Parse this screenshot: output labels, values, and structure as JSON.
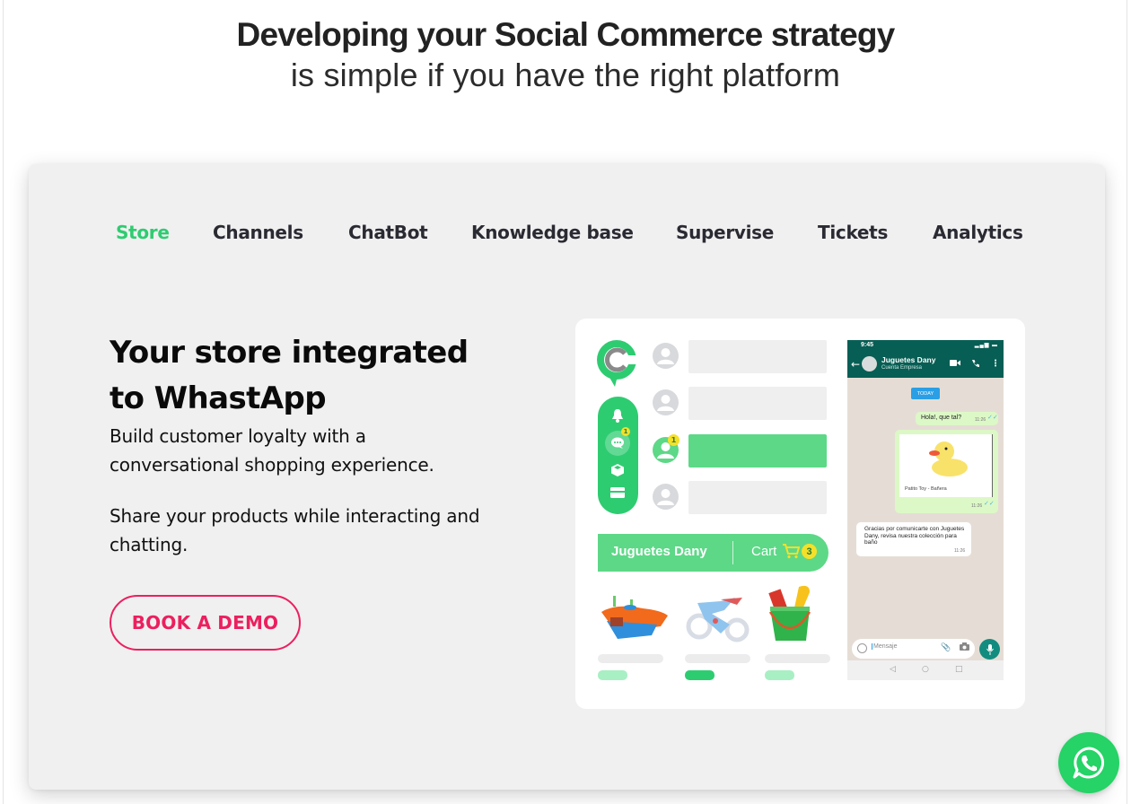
{
  "hero": {
    "title": "Developing your Social Commerce strategy",
    "subtitle": "is simple if you have the right platform"
  },
  "tabs": [
    {
      "label": "Store",
      "active": true
    },
    {
      "label": "Channels",
      "active": false
    },
    {
      "label": "ChatBot",
      "active": false
    },
    {
      "label": "Knowledge base",
      "active": false
    },
    {
      "label": "Supervise",
      "active": false
    },
    {
      "label": "Tickets",
      "active": false
    },
    {
      "label": "Analytics",
      "active": false
    }
  ],
  "content": {
    "heading": "Your store integrated to WhastApp",
    "paragraph1": "Build customer loyalty with a conversational shopping experience.",
    "paragraph2": "Share your products while interacting and chatting.",
    "cta_label": "BOOK A DEMO"
  },
  "mockup": {
    "sidebar_icons": [
      "bell-icon",
      "chat-icon",
      "box-icon",
      "card-icon"
    ],
    "chat_badge": "1",
    "active_conversation_badge": "1",
    "store_name": "Juguetes Dany",
    "cart_label": "Cart",
    "cart_count": "3",
    "products": [
      "toy-boat",
      "toy-motorbike",
      "toy-beach-bucket"
    ],
    "phone": {
      "time": "9:45",
      "contact_name": "Juguetes Dany",
      "contact_subtitle": "Cuenta Empresa",
      "date_chip": "TODAY",
      "messages": [
        {
          "direction": "out",
          "text": "Hola!, que tal?",
          "time": "11:26"
        },
        {
          "direction": "out",
          "caption": "Patito Toy - Bañera",
          "time": "11:26"
        },
        {
          "direction": "in",
          "text": "Gracias por comunicarte con Juguetes Dany, revisa nuestra colección para baño",
          "time": "11:26"
        }
      ],
      "input_placeholder": "Mensaje"
    }
  },
  "colors": {
    "accent_green": "#2ecc71",
    "cta_pink": "#ec1f5f",
    "whatsapp_dark": "#075e54",
    "whatsapp_button": "#25d366"
  }
}
